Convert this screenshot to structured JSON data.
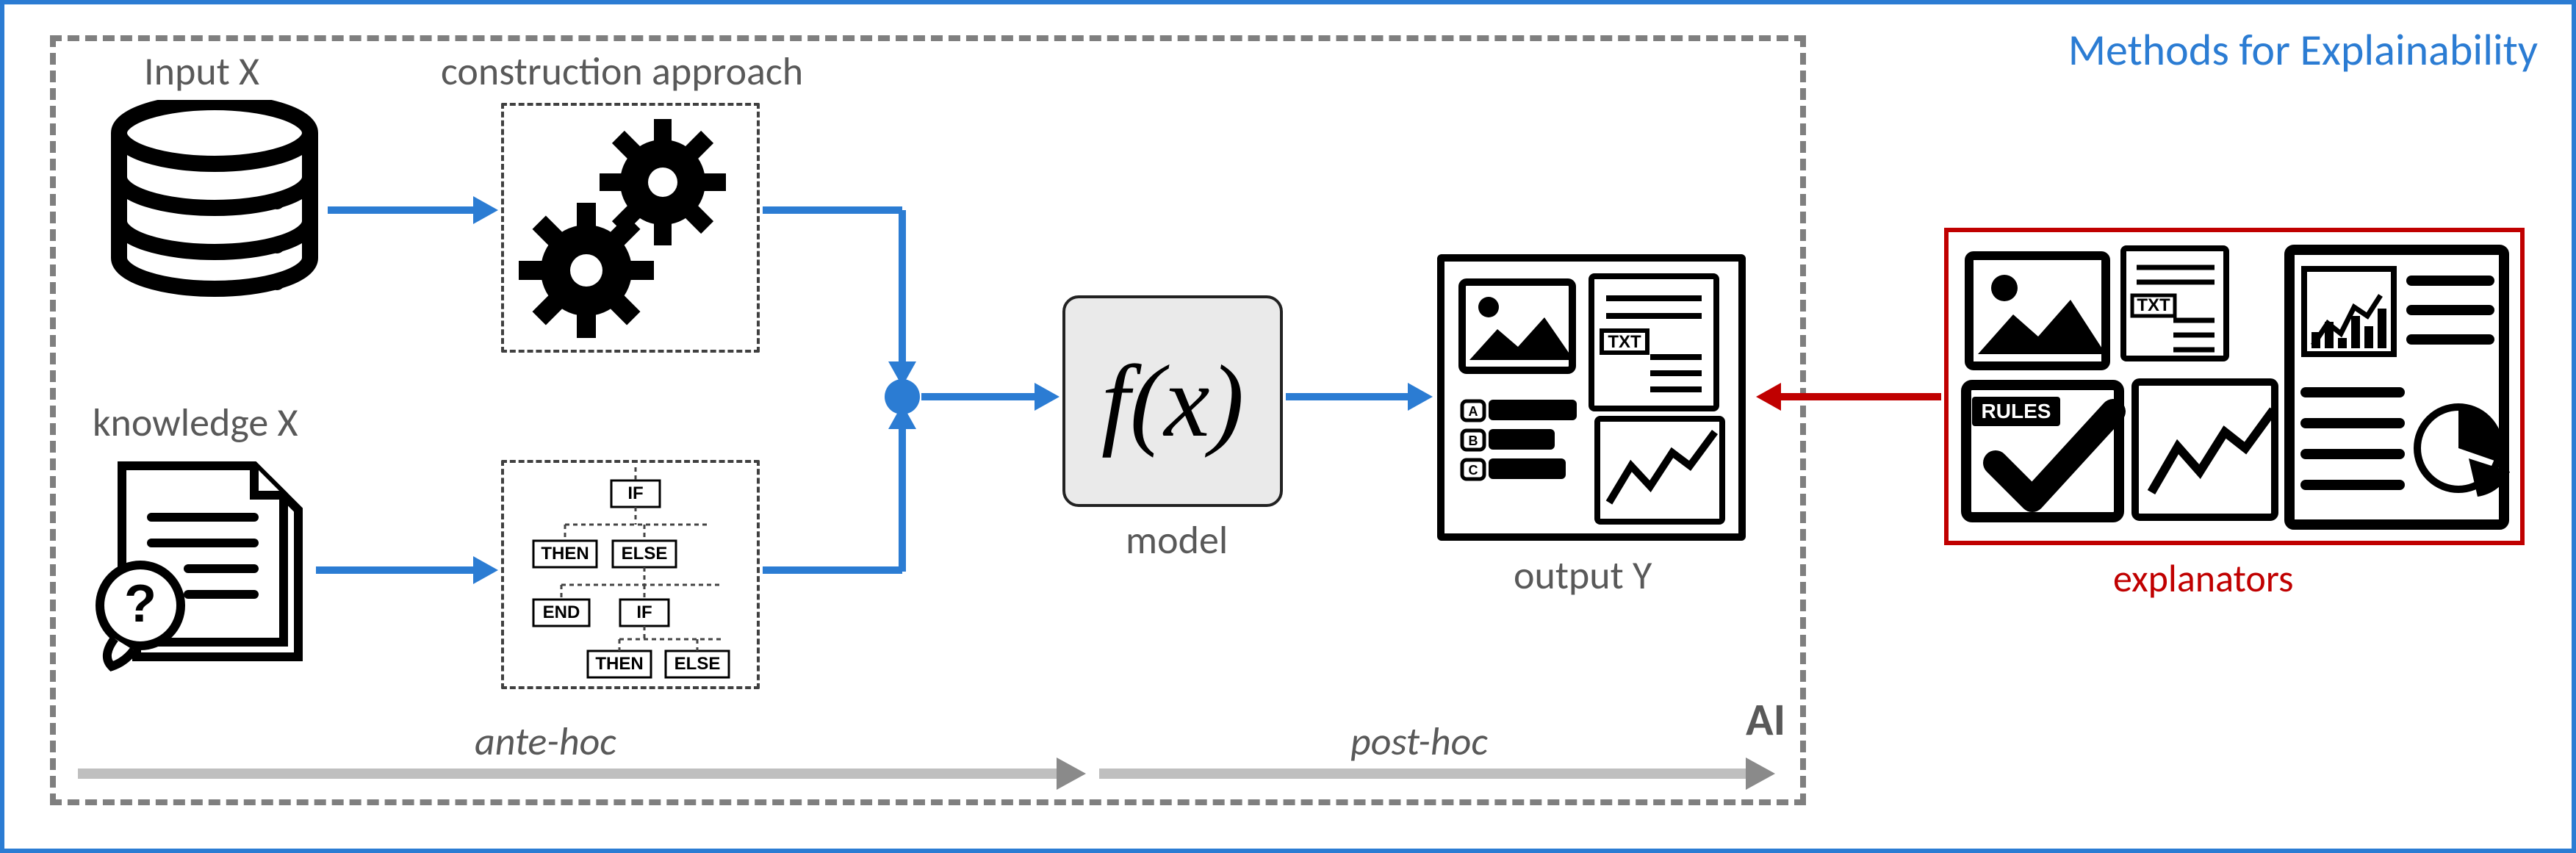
{
  "title": "Methods for Explainability",
  "ai_region_label": "AI",
  "labels": {
    "input_x": "Input X",
    "knowledge_x": "knowledge X",
    "construction_approach": "construction approach",
    "model": "model",
    "output_y": "output Y",
    "explanators": "explanators",
    "ante_hoc": "ante-hoc",
    "post_hoc": "post-hoc"
  },
  "icons": {
    "database": "database-icon",
    "gears": "gears-icon",
    "knowledge_doc": "knowledge-document-icon",
    "rule_tree": "rule-tree-icon",
    "model_fx": "f(x)",
    "output_panel": "output-panel-icon",
    "explanator_panel": "explanator-panel-icon"
  },
  "rule_tree_tokens": [
    "IF",
    "THEN",
    "ELSE",
    "END",
    "IF",
    "THEN",
    "ELSE"
  ],
  "output_icons": {
    "image_tile": "image-icon",
    "txt_doc": "TXT",
    "option_badges": [
      "A",
      "B",
      "C"
    ],
    "line_chart": "line-chart-icon"
  },
  "explanator_icons": {
    "image_tile": "image-icon",
    "txt_doc": "TXT",
    "rules_badge": "RULES",
    "checkmark": "check-icon",
    "line_chart": "line-chart-icon",
    "dashboard": "dashboard-icon",
    "bar_chart": "bar-chart-icon",
    "pie_chart": "pie-chart-icon"
  },
  "colors": {
    "frame_blue": "#2b7cd3",
    "arrow_blue": "#2b7cd3",
    "red": "#c00000",
    "grey_text": "#595959",
    "grey_arrow": "#bfbfbf"
  }
}
